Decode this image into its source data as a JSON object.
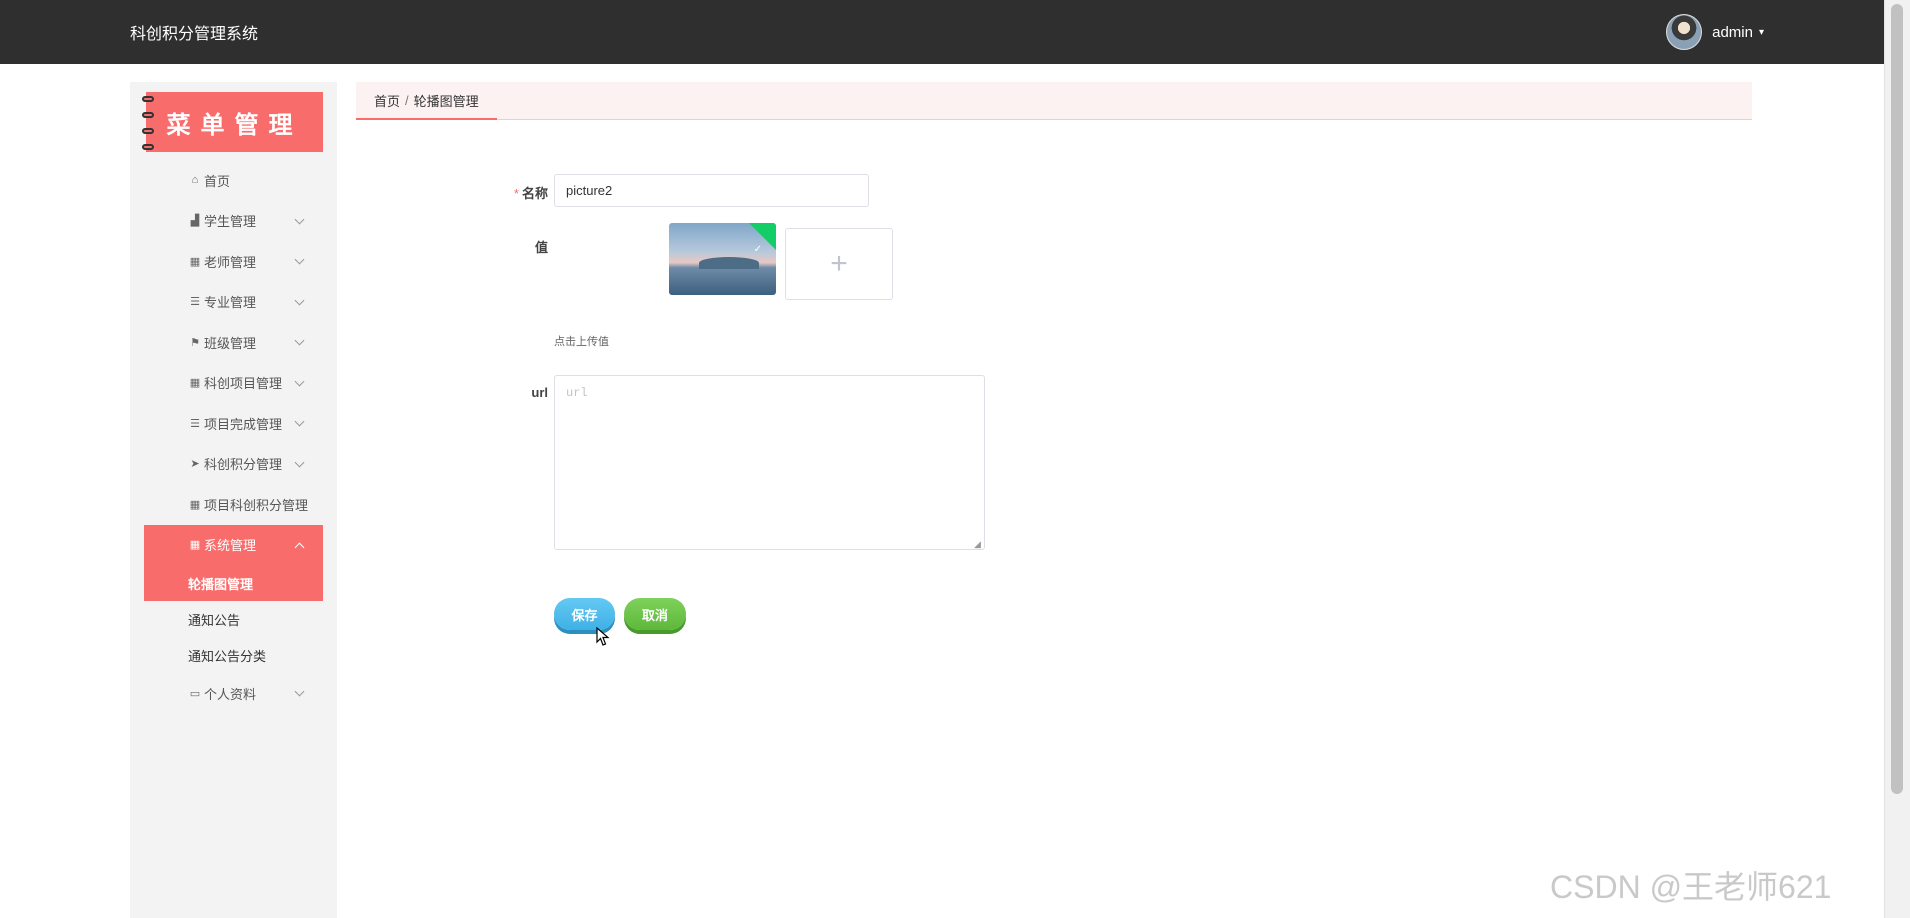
{
  "header": {
    "app_title": "科创积分管理系统",
    "username": "admin",
    "caret": "▾"
  },
  "sidebar": {
    "banner_title": "菜单管理",
    "items": [
      {
        "label": "首页",
        "icon": "home-icon",
        "has_children": false
      },
      {
        "label": "学生管理",
        "icon": "bar-chart-icon",
        "has_children": true
      },
      {
        "label": "老师管理",
        "icon": "grid-icon",
        "has_children": true
      },
      {
        "label": "专业管理",
        "icon": "list-icon",
        "has_children": true
      },
      {
        "label": "班级管理",
        "icon": "flag-icon",
        "has_children": true
      },
      {
        "label": "科创项目管理",
        "icon": "grid-icon",
        "has_children": true
      },
      {
        "label": "项目完成管理",
        "icon": "list-icon",
        "has_children": true
      },
      {
        "label": "科创积分管理",
        "icon": "send-icon",
        "has_children": true
      },
      {
        "label": "项目科创积分管理",
        "icon": "grid-icon",
        "has_children": false
      },
      {
        "label": "系统管理",
        "icon": "grid-icon",
        "has_children": true,
        "expanded": true
      },
      {
        "label": "个人资料",
        "icon": "id-card-icon",
        "has_children": true
      }
    ],
    "system_children": [
      "轮播图管理",
      "通知公告",
      "通知公告分类"
    ]
  },
  "breadcrumb": {
    "home": "首页",
    "separator": "/",
    "current": "轮播图管理"
  },
  "form": {
    "name_label": "名称",
    "name_value": "picture2",
    "value_label": "值",
    "upload_tip": "点击上传值",
    "upload_plus": "+",
    "url_label": "url",
    "url_placeholder": "url",
    "save_label": "保存",
    "cancel_label": "取消"
  },
  "watermark": "CSDN @王老师621",
  "colors": {
    "accent": "#f96c6c",
    "topbar": "#2f2f2f",
    "save": "#3fb0e6",
    "cancel": "#5db83b"
  }
}
